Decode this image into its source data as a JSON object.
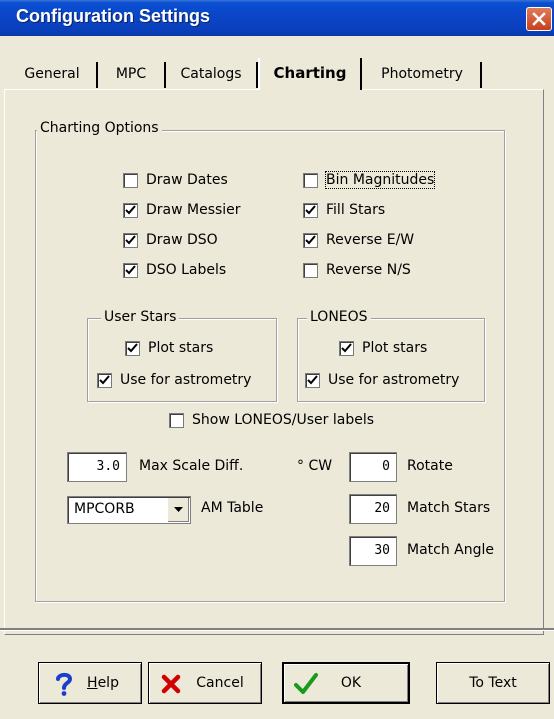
{
  "window": {
    "title": "Configuration Settings"
  },
  "tabs": [
    {
      "label": "General"
    },
    {
      "label": "MPC"
    },
    {
      "label": "Catalogs"
    },
    {
      "label": "Charting",
      "active": true
    },
    {
      "label": "Photometry"
    }
  ],
  "charting_options": {
    "group_label": "Charting Options",
    "left_checks": [
      {
        "label": "Draw Dates",
        "checked": false
      },
      {
        "label": "Draw Messier",
        "checked": true
      },
      {
        "label": "Draw DSO",
        "checked": true
      },
      {
        "label": "DSO Labels",
        "checked": true
      }
    ],
    "right_checks": [
      {
        "label": "Bin Magnitudes",
        "checked": false
      },
      {
        "label": "Fill Stars",
        "checked": true
      },
      {
        "label": "Reverse E/W",
        "checked": true
      },
      {
        "label": "Reverse N/S",
        "checked": false
      }
    ]
  },
  "user_stars": {
    "group_label": "User Stars",
    "plot_stars": {
      "label": "Plot stars",
      "checked": true
    },
    "astrometry": {
      "label": "Use for astrometry",
      "checked": true
    }
  },
  "loneos": {
    "group_label": "LONEOS",
    "plot_stars": {
      "label": "Plot stars",
      "checked": true
    },
    "astrometry": {
      "label": "Use for astrometry",
      "checked": true
    }
  },
  "show_labels": {
    "label": "Show LONEOS/User labels",
    "checked": false
  },
  "max_scale": {
    "value": "3.0",
    "label": "Max Scale Diff."
  },
  "am_table": {
    "value": "MPCORB",
    "label": "AM Table"
  },
  "rotate": {
    "prefix": "° CW",
    "value": "0",
    "label": "Rotate"
  },
  "match_stars": {
    "value": "20",
    "label": "Match Stars"
  },
  "match_angle": {
    "value": "30",
    "label": "Match Angle"
  },
  "buttons": {
    "help_prefix": "H",
    "help_rest": "elp",
    "cancel": "Cancel",
    "ok": "OK",
    "to_text": "To Text"
  },
  "colors": {
    "titlebar": "#0a46c8",
    "dialog": "#ece9d8"
  }
}
